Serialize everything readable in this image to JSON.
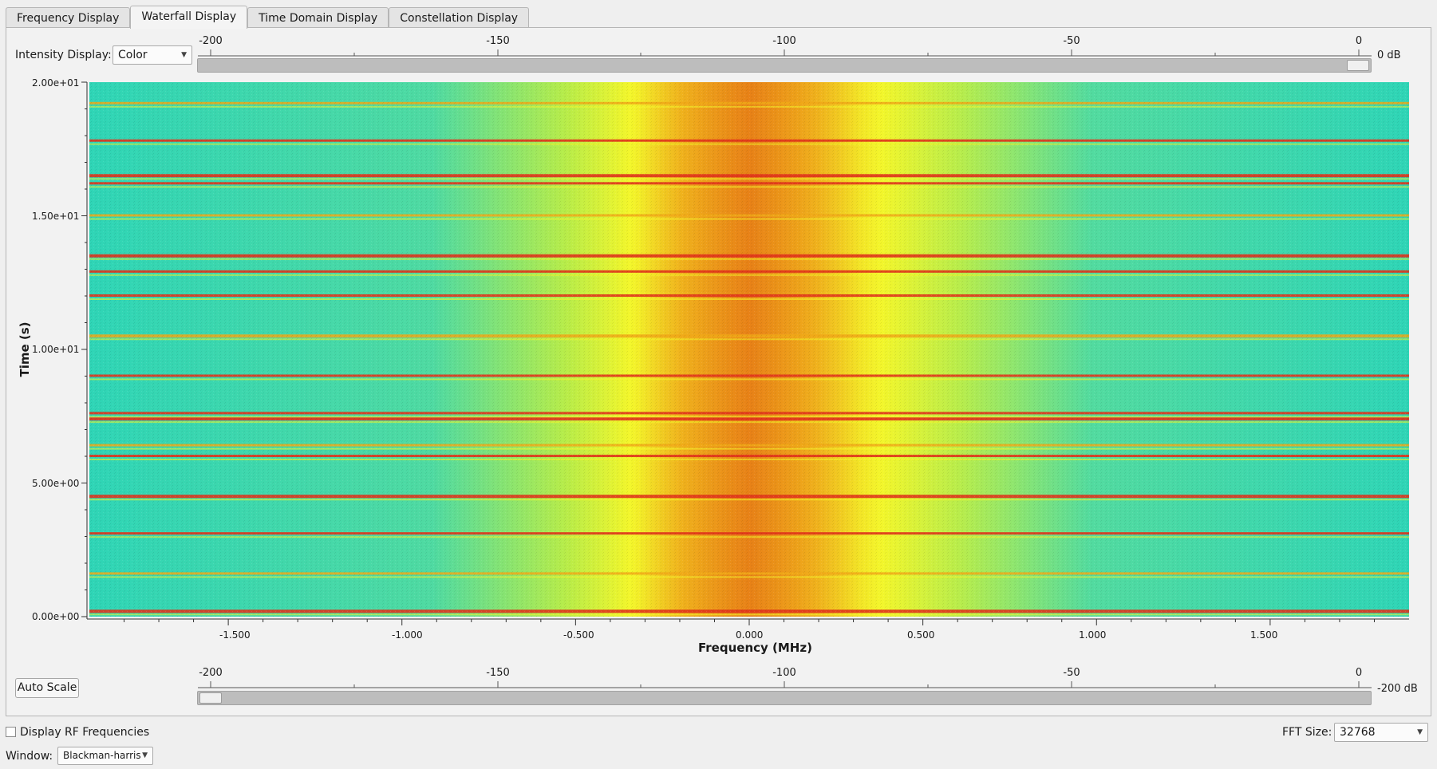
{
  "tabs": [
    {
      "label": "Frequency Display",
      "active": false
    },
    {
      "label": "Waterfall Display",
      "active": true
    },
    {
      "label": "Time Domain Display",
      "active": false
    },
    {
      "label": "Constellation Display",
      "active": false
    }
  ],
  "intensity": {
    "label": "Intensity Display:",
    "value": "Color"
  },
  "top_slider": {
    "ticks": [
      "-200",
      "-150",
      "-100",
      "-50",
      "0"
    ],
    "value_label": "0 dB",
    "value_db": 0
  },
  "bottom_slider": {
    "ticks": [
      "-200",
      "-150",
      "-100",
      "-50",
      "0"
    ],
    "value_label": "-200 dB",
    "value_db": -200
  },
  "auto_scale_label": "Auto Scale",
  "rf_checkbox": {
    "label": "Display RF Frequencies",
    "checked": false
  },
  "fft": {
    "label": "FFT Size:",
    "value": "32768"
  },
  "window": {
    "label": "Window:",
    "value": "Blackman-harris"
  },
  "icons": {
    "dropdown": "chevron-down-icon"
  },
  "chart_data": {
    "type": "heatmap",
    "xlabel": "Frequency (MHz)",
    "ylabel": "Time (s)",
    "xlim": [
      -1.9,
      1.9
    ],
    "ylim": [
      0,
      20
    ],
    "x_ticks": [
      "-1.500",
      "-1.000",
      "-0.500",
      "0.000",
      "0.500",
      "1.000",
      "1.500"
    ],
    "y_ticks": [
      "0.00e+00",
      "5.00e+00",
      "1.00e+01",
      "1.50e+01",
      "2.00e+01"
    ],
    "colormap": [
      "#2fd6b4",
      "#7ee07a",
      "#f4f62a",
      "#f0a818",
      "#e0341c"
    ],
    "signal_center_mhz": 0.0,
    "signal_width_mhz": 0.9,
    "strong_rows_s": [
      0.2,
      1.6,
      3.1,
      4.5,
      6.0,
      6.4,
      7.4,
      7.6,
      9.0,
      10.5,
      12.0,
      12.9,
      13.5,
      15.0,
      16.2,
      16.5,
      17.8,
      19.2
    ]
  }
}
